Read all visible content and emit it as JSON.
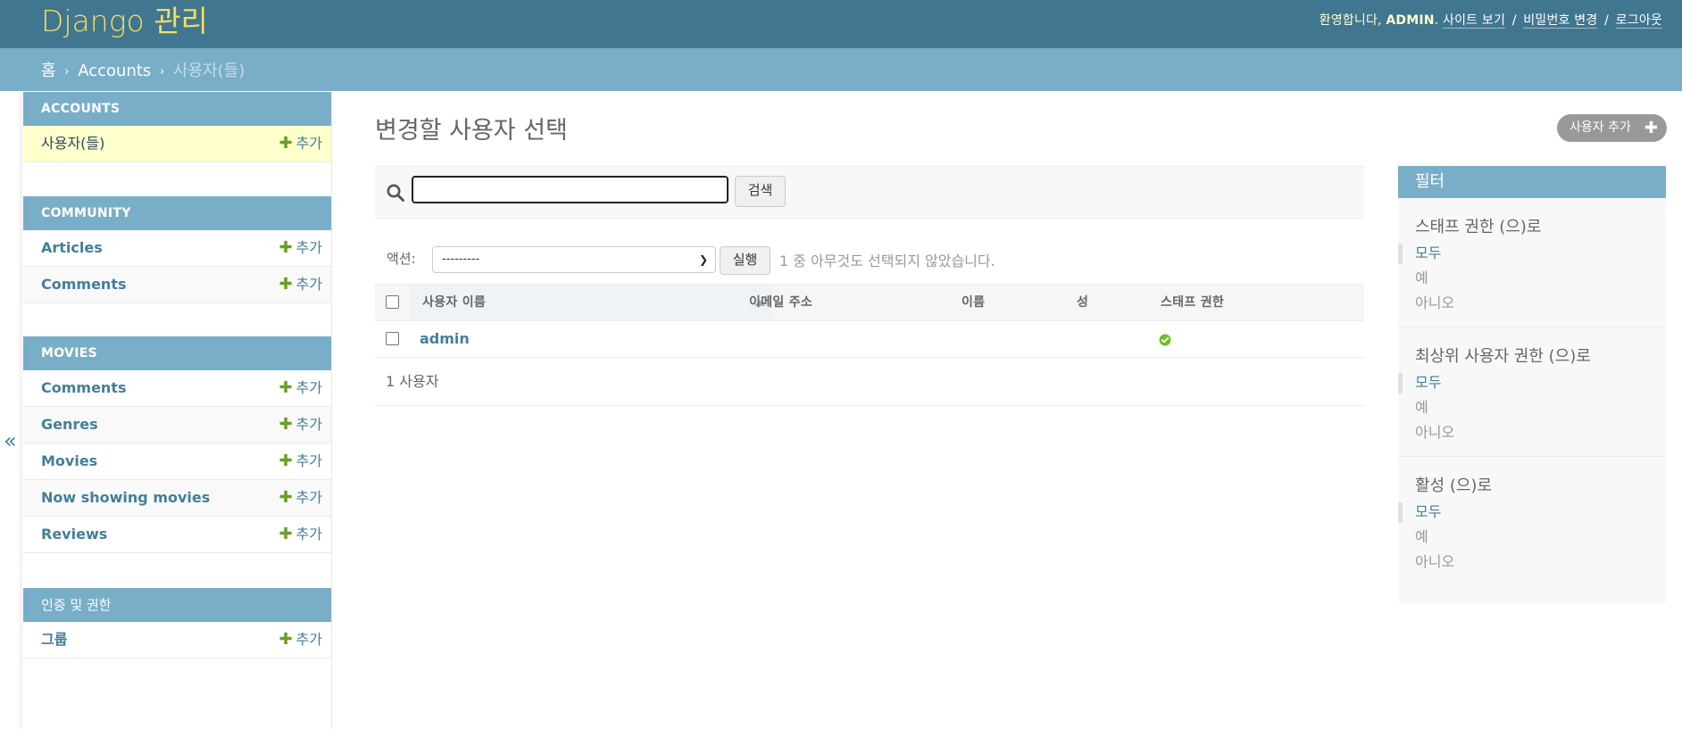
{
  "header": {
    "brand": "Django 관리",
    "welcome": "환영합니다,",
    "username": "ADMIN",
    "period": ".",
    "view_site": "사이트 보기",
    "change_password": "비밀번호 변경",
    "logout": "로그아웃",
    "separator": "/"
  },
  "breadcrumbs": {
    "home": "홈",
    "sep": "›",
    "app": "Accounts",
    "current": "사용자(들)"
  },
  "sidebar": {
    "toggle": "«",
    "add_label": "추가",
    "plus": "✚",
    "apps": [
      {
        "caption": "ACCOUNTS",
        "models": [
          {
            "name": "사용자(들)",
            "current": true
          }
        ]
      },
      {
        "caption": "COMMUNITY",
        "models": [
          {
            "name": "Articles"
          },
          {
            "name": "Comments"
          }
        ]
      },
      {
        "caption": "MOVIES",
        "models": [
          {
            "name": "Comments"
          },
          {
            "name": "Genres"
          },
          {
            "name": "Movies"
          },
          {
            "name": "Now showing movies"
          },
          {
            "name": "Reviews"
          }
        ]
      },
      {
        "caption": "인증 및 권한",
        "models": [
          {
            "name": "그룹"
          }
        ]
      }
    ]
  },
  "content": {
    "title": "변경할 사용자 선택",
    "add_button": "사용자 추가",
    "add_plus": "✚",
    "search_button": "검색",
    "search_value": "",
    "actions_label": "액션:",
    "action_selected": "---------",
    "go_button": "실행",
    "action_counter": "1 중 아무것도 선택되지 않았습니다.",
    "columns": {
      "username": "사용자 이름",
      "email": "이메일 주소",
      "first_name": "이름",
      "last_name": "성",
      "is_staff": "스태프 권한"
    },
    "rows": [
      {
        "username": "admin",
        "email": "",
        "first_name": "",
        "last_name": "",
        "is_staff": true
      }
    ],
    "paginator": "1 사용자"
  },
  "filter": {
    "title": "필터",
    "groups": [
      {
        "heading": "스태프 권한 (으)로",
        "options": [
          "모두",
          "예",
          "아니오"
        ],
        "selected": 0
      },
      {
        "heading": "최상위 사용자 권한 (으)로",
        "options": [
          "모두",
          "예",
          "아니오"
        ],
        "selected": 0
      },
      {
        "heading": "활성 (으)로",
        "options": [
          "모두",
          "예",
          "아니오"
        ],
        "selected": 0
      }
    ]
  },
  "colors": {
    "header_bg": "#417690",
    "breadcrumb_bg": "#79aec8",
    "brand": "#f5dd5d",
    "link": "#447e9b",
    "add_plus": "#6a9f26",
    "current_row": "#ffffcc"
  }
}
